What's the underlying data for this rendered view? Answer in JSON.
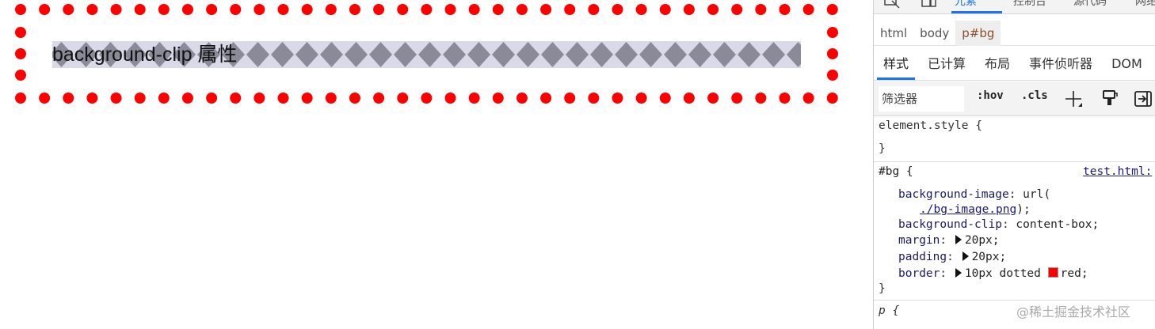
{
  "preview": {
    "element_text": "background-clip 属性",
    "border_color": "#ff0000",
    "content_tile_color": "#8a8a99"
  },
  "devtools": {
    "top_tabs": [
      "元素",
      "控制台",
      "源代码",
      "网络"
    ],
    "breadcrumb": [
      "html",
      "body",
      "p#bg"
    ],
    "subtabs": [
      "样式",
      "已计算",
      "布局",
      "事件侦听器",
      "DOM"
    ],
    "filter": {
      "placeholder": "筛选器",
      "hov_label": ":hov",
      "cls_label": ".cls"
    },
    "icons": {
      "inspect": "inspect-icon",
      "device": "device-toggle-icon",
      "add_rule": "plus-icon",
      "paint": "paint-brush-icon",
      "sidebar": "toggle-sidebar-icon"
    },
    "element_style": {
      "open": "element.style {",
      "close": "}"
    },
    "rule": {
      "selector": "#bg {",
      "source": "test.html:",
      "bg_image_name": "background-image",
      "bg_image_prefix": "url(",
      "bg_image_url": "./bg-image.png",
      "bg_image_suffix": ");",
      "bg_clip_name": "background-clip",
      "bg_clip_value": "content-box;",
      "margin_name": "margin",
      "margin_value": "20px;",
      "padding_name": "padding",
      "padding_value": "20px;",
      "border_name": "border",
      "border_value_pre": "10px dotted",
      "border_value_color": "red;",
      "close": "}"
    },
    "next_selector": "p {",
    "watermark": "@稀土掘金技术社区"
  }
}
